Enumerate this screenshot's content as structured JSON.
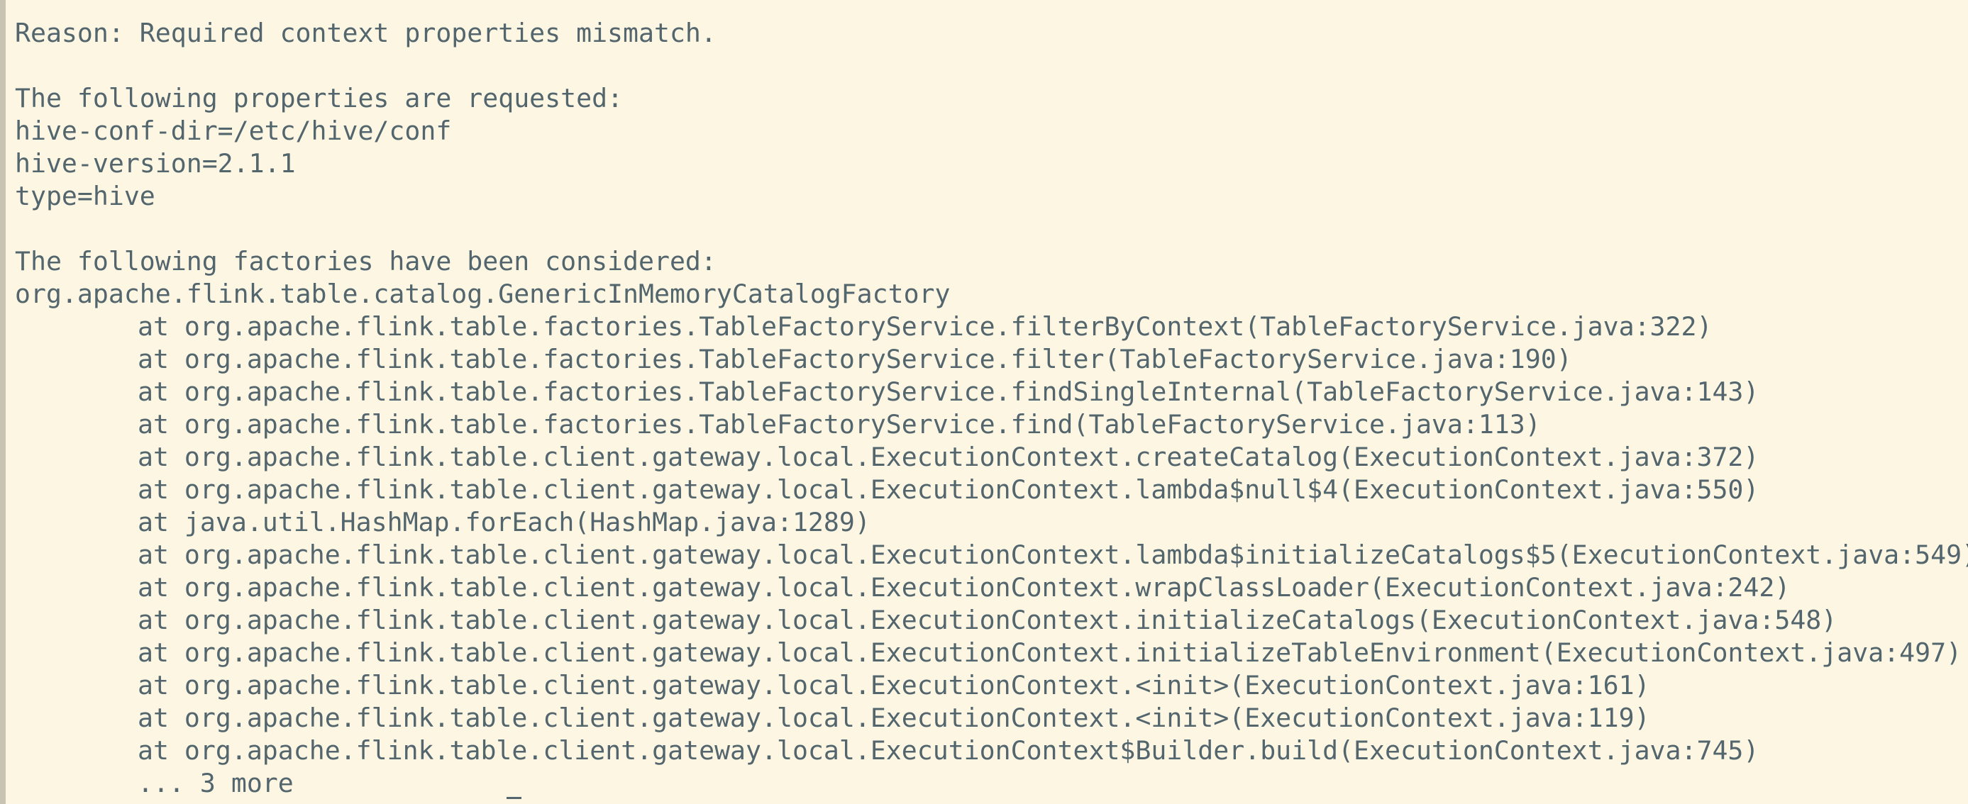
{
  "terminal": {
    "reason": "Reason: Required context properties mismatch.",
    "requested_header": "The following properties are requested:",
    "properties": [
      "hive-conf-dir=/etc/hive/conf",
      "hive-version=2.1.1",
      "type=hive"
    ],
    "factories_header": "The following factories have been considered:",
    "factory": "org.apache.flink.table.catalog.GenericInMemoryCatalogFactory",
    "stack": [
      "at org.apache.flink.table.factories.TableFactoryService.filterByContext(TableFactoryService.java:322)",
      "at org.apache.flink.table.factories.TableFactoryService.filter(TableFactoryService.java:190)",
      "at org.apache.flink.table.factories.TableFactoryService.findSingleInternal(TableFactoryService.java:143)",
      "at org.apache.flink.table.factories.TableFactoryService.find(TableFactoryService.java:113)",
      "at org.apache.flink.table.client.gateway.local.ExecutionContext.createCatalog(ExecutionContext.java:372)",
      "at org.apache.flink.table.client.gateway.local.ExecutionContext.lambda$null$4(ExecutionContext.java:550)",
      "at java.util.HashMap.forEach(HashMap.java:1289)",
      "at org.apache.flink.table.client.gateway.local.ExecutionContext.lambda$initializeCatalogs$5(ExecutionContext.java:549)",
      "at org.apache.flink.table.client.gateway.local.ExecutionContext.wrapClassLoader(ExecutionContext.java:242)",
      "at org.apache.flink.table.client.gateway.local.ExecutionContext.initializeCatalogs(ExecutionContext.java:548)",
      "at org.apache.flink.table.client.gateway.local.ExecutionContext.initializeTableEnvironment(ExecutionContext.java:497)",
      "at org.apache.flink.table.client.gateway.local.ExecutionContext.<init>(ExecutionContext.java:161)",
      "at org.apache.flink.table.client.gateway.local.ExecutionContext.<init>(ExecutionContext.java:119)",
      "at org.apache.flink.table.client.gateway.local.ExecutionContext$Builder.build(ExecutionContext.java:745)"
    ],
    "more": "... 3 more",
    "colors": {
      "background": "#fdf6e3",
      "text": "#53656d"
    }
  }
}
